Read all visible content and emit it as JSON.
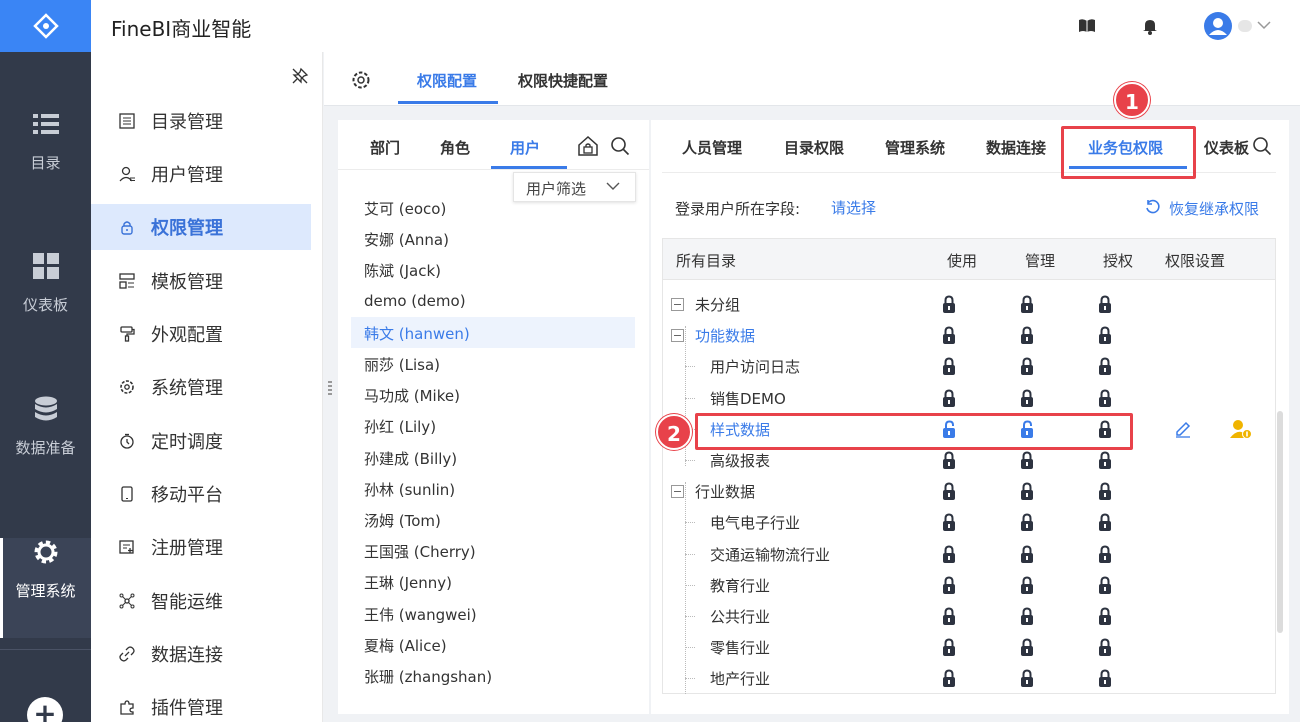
{
  "header": {
    "title": "FineBI商业智能"
  },
  "rail": [
    {
      "label": "目录",
      "icon": "list-icon"
    },
    {
      "label": "仪表板",
      "icon": "dashboard-icon"
    },
    {
      "label": "数据准备",
      "icon": "database-icon"
    },
    {
      "label": "管理系统",
      "icon": "gear-icon"
    }
  ],
  "menu": [
    {
      "label": "目录管理"
    },
    {
      "label": "用户管理"
    },
    {
      "label": "权限管理"
    },
    {
      "label": "模板管理"
    },
    {
      "label": "外观配置"
    },
    {
      "label": "系统管理"
    },
    {
      "label": "定时调度"
    },
    {
      "label": "移动平台"
    },
    {
      "label": "注册管理"
    },
    {
      "label": "智能运维"
    },
    {
      "label": "数据连接"
    },
    {
      "label": "插件管理"
    }
  ],
  "top_tabs": {
    "perm_config": "权限配置",
    "perm_quick": "权限快捷配置"
  },
  "left_tabs": {
    "dept": "部门",
    "role": "角色",
    "user": "用户"
  },
  "user_filter": "用户筛选",
  "users": [
    "艾可 (eoco)",
    "安娜 (Anna)",
    "陈斌 (Jack)",
    "demo (demo)",
    "韩文 (hanwen)",
    "丽莎 (Lisa)",
    "马功成 (Mike)",
    "孙红 (Lily)",
    "孙建成 (Billy)",
    "孙林 (sunlin)",
    "汤姆 (Tom)",
    "王国强 (Cherry)",
    "王琳 (Jenny)",
    "王伟 (wangwei)",
    "夏梅 (Alice)",
    "张珊 (zhangshan)"
  ],
  "right_tabs": {
    "people": "人员管理",
    "catalog": "目录权限",
    "admin": "管理系统",
    "dataconn": "数据连接",
    "bizpkg": "业务包权限",
    "dashboard": "仪表板"
  },
  "login_field_label": "登录用户所在字段:",
  "please_select": "请选择",
  "restore": "恢复继承权限",
  "columns": {
    "all": "所有目录",
    "use": "使用",
    "manage": "管理",
    "grant": "授权",
    "settings": "权限设置"
  },
  "tree": [
    {
      "label": "未分组",
      "level": 0
    },
    {
      "label": "功能数据",
      "level": 0,
      "blue": true
    },
    {
      "label": "用户访问日志",
      "level": 1
    },
    {
      "label": "销售DEMO",
      "level": 1
    },
    {
      "label": "样式数据",
      "level": 1,
      "blue": true,
      "unlocked_use": true,
      "unlocked_manage": true
    },
    {
      "label": "高级报表",
      "level": 1
    },
    {
      "label": "行业数据",
      "level": 0
    },
    {
      "label": "电气电子行业",
      "level": 1
    },
    {
      "label": "交通运输物流行业",
      "level": 1
    },
    {
      "label": "教育行业",
      "level": 1
    },
    {
      "label": "公共行业",
      "level": 1
    },
    {
      "label": "零售行业",
      "level": 1
    },
    {
      "label": "地产行业",
      "level": 1
    }
  ],
  "callouts": [
    "1",
    "2"
  ],
  "colors": {
    "accent": "#3a7be8",
    "rail": "#323a4a",
    "highlight": "#e8424a"
  }
}
